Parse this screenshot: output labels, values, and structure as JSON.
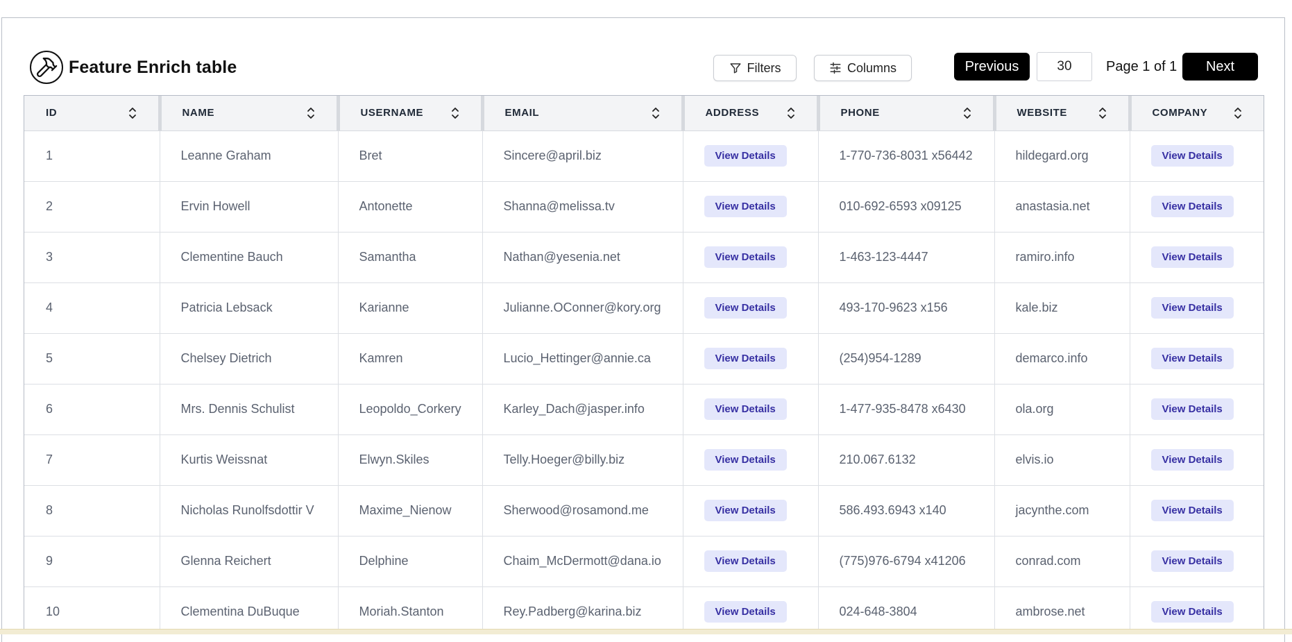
{
  "header": {
    "title": "Feature Enrich table",
    "logo_icon": "hammer-icon"
  },
  "toolbar": {
    "filters_label": "Filters",
    "columns_label": "Columns",
    "previous_label": "Previous",
    "page_size_value": "30",
    "page_info": "Page 1 of 1",
    "next_label": "Next"
  },
  "table": {
    "columns": [
      "ID",
      "NAME",
      "USERNAME",
      "EMAIL",
      "ADDRESS",
      "PHONE",
      "WEBSITE",
      "COMPANY"
    ],
    "action_label": "View Details",
    "rows": [
      {
        "id": "1",
        "name": "Leanne Graham",
        "username": "Bret",
        "email": "Sincere@april.biz",
        "phone": "1-770-736-8031 x56442",
        "website": "hildegard.org"
      },
      {
        "id": "2",
        "name": "Ervin Howell",
        "username": "Antonette",
        "email": "Shanna@melissa.tv",
        "phone": "010-692-6593 x09125",
        "website": "anastasia.net"
      },
      {
        "id": "3",
        "name": "Clementine Bauch",
        "username": "Samantha",
        "email": "Nathan@yesenia.net",
        "phone": "1-463-123-4447",
        "website": "ramiro.info"
      },
      {
        "id": "4",
        "name": "Patricia Lebsack",
        "username": "Karianne",
        "email": "Julianne.OConner@kory.org",
        "phone": "493-170-9623 x156",
        "website": "kale.biz"
      },
      {
        "id": "5",
        "name": "Chelsey Dietrich",
        "username": "Kamren",
        "email": "Lucio_Hettinger@annie.ca",
        "phone": "(254)954-1289",
        "website": "demarco.info"
      },
      {
        "id": "6",
        "name": "Mrs. Dennis Schulist",
        "username": "Leopoldo_Corkery",
        "email": "Karley_Dach@jasper.info",
        "phone": "1-477-935-8478 x6430",
        "website": "ola.org"
      },
      {
        "id": "7",
        "name": "Kurtis Weissnat",
        "username": "Elwyn.Skiles",
        "email": "Telly.Hoeger@billy.biz",
        "phone": "210.067.6132",
        "website": "elvis.io"
      },
      {
        "id": "8",
        "name": "Nicholas Runolfsdottir V",
        "username": "Maxime_Nienow",
        "email": "Sherwood@rosamond.me",
        "phone": "586.493.6943 x140",
        "website": "jacynthe.com"
      },
      {
        "id": "9",
        "name": "Glenna Reichert",
        "username": "Delphine",
        "email": "Chaim_McDermott@dana.io",
        "phone": "(775)976-6794 x41206",
        "website": "conrad.com"
      },
      {
        "id": "10",
        "name": "Clementina DuBuque",
        "username": "Moriah.Stanton",
        "email": "Rey.Padberg@karina.biz",
        "phone": "024-648-3804",
        "website": "ambrose.net"
      }
    ]
  },
  "colors": {
    "accent_dark": "#000000",
    "badge_bg": "#e4e7fb",
    "badge_text": "#3730a3",
    "header_bg": "#f3f4f6"
  }
}
